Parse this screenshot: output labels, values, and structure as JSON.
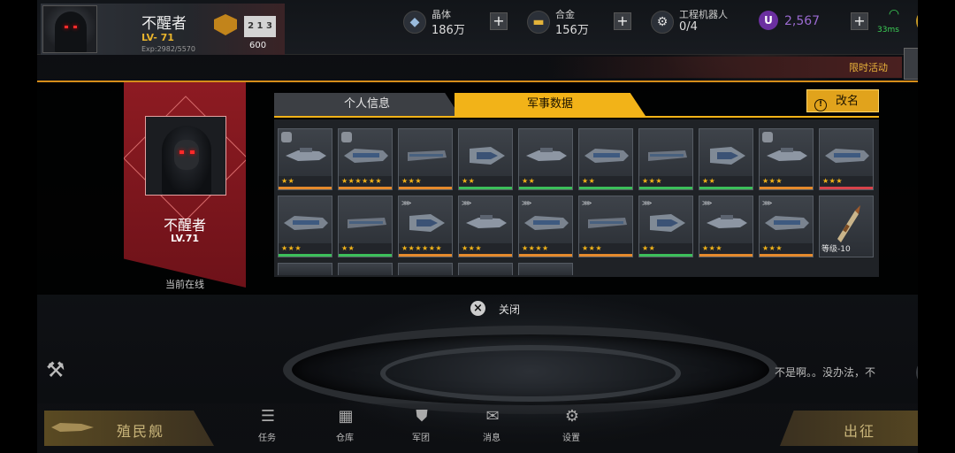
{
  "player": {
    "name": "不醒者",
    "level": "LV- 71",
    "exp": "Exp:2982/5570",
    "rank_value": "600",
    "podium": "2 1 3"
  },
  "resources": {
    "crystal": {
      "label": "晶体",
      "value": "186万",
      "icon": "crystal-icon"
    },
    "alloy": {
      "label": "合金",
      "value": "156万",
      "icon": "alloy-icon"
    },
    "robots": {
      "label": "工程机器人",
      "value": "0/4",
      "icon": "robot-icon"
    },
    "ucoin": {
      "symbol": "U",
      "value": "2,567"
    }
  },
  "network": {
    "ping": "33ms"
  },
  "event": {
    "label": "限时活动"
  },
  "profile": {
    "name": "不醒者",
    "level": "LV.71",
    "status": "当前在线"
  },
  "tabs": [
    {
      "label": "个人信息",
      "active": false
    },
    {
      "label": "军事数据",
      "active": true
    }
  ],
  "rename_label": "改名",
  "rename_icon": "!",
  "weapons_row1": [
    {
      "stars": "★★",
      "rarity": "#e58a2c"
    },
    {
      "stars": "★★★★★★",
      "rarity": "#e58a2c"
    },
    {
      "stars": "★★★",
      "rarity": "#e58a2c"
    },
    {
      "stars": "★★",
      "rarity": "#3cbf5a"
    },
    {
      "stars": "★★",
      "rarity": "#3cbf5a"
    },
    {
      "stars": "★★",
      "rarity": "#3cbf5a"
    },
    {
      "stars": "★★★",
      "rarity": "#3cbf5a"
    },
    {
      "stars": "★★",
      "rarity": "#3cbf5a"
    },
    {
      "stars": "★★★",
      "rarity": "#e58a2c"
    },
    {
      "stars": "★★★",
      "rarity": "#d8434b"
    }
  ],
  "weapons_row2": [
    {
      "stars": "★★★",
      "rarity": "#3cbf5a"
    },
    {
      "stars": "★★",
      "rarity": "#3cbf5a"
    },
    {
      "stars": "★★★★★★",
      "rarity": "#e58a2c"
    },
    {
      "stars": "★★★",
      "rarity": "#e58a2c"
    },
    {
      "stars": "★★★★",
      "rarity": "#e58a2c"
    },
    {
      "stars": "★★★",
      "rarity": "#e58a2c"
    },
    {
      "stars": "★★",
      "rarity": "#3cbf5a"
    },
    {
      "stars": "★★★",
      "rarity": "#e58a2c"
    },
    {
      "stars": "★★★",
      "rarity": "#e58a2c"
    }
  ],
  "special_item": {
    "level": "等级-10"
  },
  "close_label": "关闭",
  "chat_text": "不是啊。。没办法，不",
  "colony_label": "殖民舰",
  "sortie_label": "出征",
  "nav": [
    {
      "label": "任务",
      "icon": "task-icon"
    },
    {
      "label": "仓库",
      "icon": "warehouse-icon"
    },
    {
      "label": "军团",
      "icon": "legion-icon"
    },
    {
      "label": "消息",
      "icon": "message-icon"
    },
    {
      "label": "设置",
      "icon": "settings-icon"
    }
  ],
  "colors": {
    "accent": "#f2b318",
    "banner": "#8d1b22",
    "online": "#3ccf56",
    "premium": "#6b2fa0"
  }
}
